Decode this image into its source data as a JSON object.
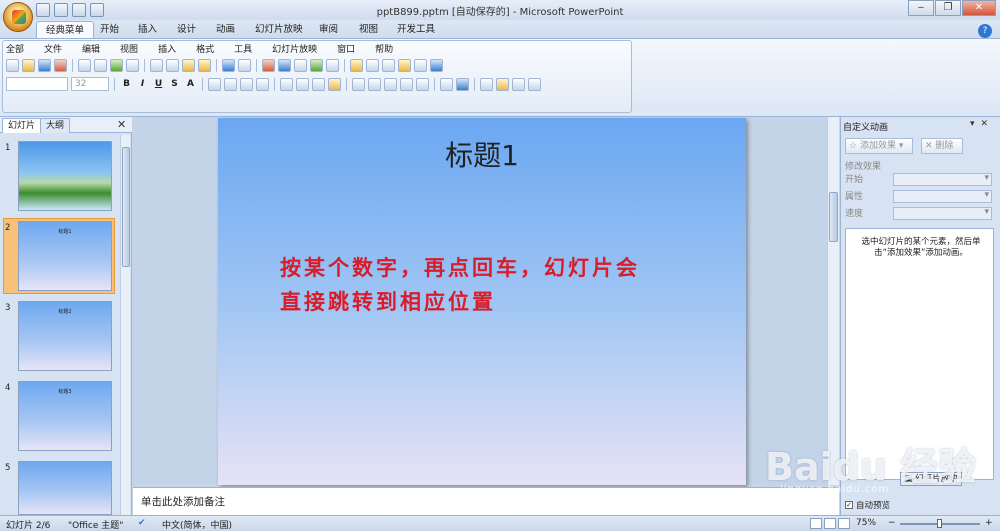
{
  "window": {
    "title": "pptB899.pptm [自动保存的] - Microsoft PowerPoint"
  },
  "ribbon_tabs": [
    "经典菜单",
    "开始",
    "插入",
    "设计",
    "动画",
    "幻灯片放映",
    "审阅",
    "视图",
    "开发工具"
  ],
  "classic_menu": [
    "全部",
    "文件",
    "编辑",
    "视图",
    "插入",
    "格式",
    "工具",
    "幻灯片放映",
    "窗口",
    "帮助"
  ],
  "font_size": "32",
  "format_buttons": [
    "B",
    "I",
    "U",
    "S",
    "A"
  ],
  "left_panel": {
    "tabs": [
      "幻灯片",
      "大纲"
    ],
    "slides": [
      {
        "num": "1",
        "title": ""
      },
      {
        "num": "2",
        "title": "标题1"
      },
      {
        "num": "3",
        "title": "标题2"
      },
      {
        "num": "4",
        "title": "标题3"
      },
      {
        "num": "5",
        "title": ""
      }
    ]
  },
  "slide": {
    "title": "标题1",
    "body_line1": "按某个数字，再点回车，幻灯片会",
    "body_line2": "直接跳转到相应位置"
  },
  "notes_placeholder": "单击此处添加备注",
  "task_pane": {
    "title": "自定义动画",
    "add_effect": "添加效果",
    "remove": "删除",
    "modify_label": "修改效果",
    "start_label": "开始",
    "property_label": "属性",
    "speed_label": "速度",
    "hint": "选中幻灯片的某个元素，然后单击“添加效果”添加动画。",
    "slideshow_button": "幻灯片放映",
    "autopreview": "自动预览"
  },
  "status_bar": {
    "slide_pos": "幻灯片 2/6",
    "theme": "\"Office 主题\"",
    "language": "中文(简体，中国)",
    "zoom": "75%"
  },
  "watermark": {
    "brand": "Baidu 经验",
    "url": "jingyan.baidu.com"
  }
}
